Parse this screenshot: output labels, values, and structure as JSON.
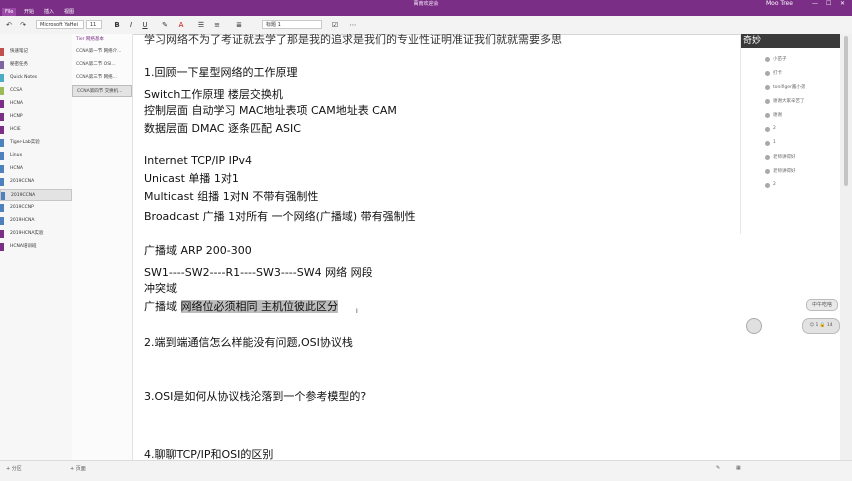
{
  "window": {
    "title": "萬南欢迎会",
    "right_label": "Moo Tree",
    "controls": [
      "—",
      "☐",
      "✕"
    ]
  },
  "menu": [
    "File",
    "开始",
    "插入",
    "视图"
  ],
  "ribbon": {
    "font_name": "Microsoft YaHei",
    "font_size": "11",
    "style_label": "标题 1",
    "buttons": [
      "B",
      "I",
      "U"
    ]
  },
  "sections": {
    "heading": "",
    "items": [
      {
        "label": "快速笔记",
        "color": "#c0504d"
      },
      {
        "label": "秘密任务",
        "color": "#8064a2"
      },
      {
        "label": "Quick Notes",
        "color": "#4bacc6"
      },
      {
        "label": "CCSA",
        "color": "#9bbb59"
      },
      {
        "label": "HCNA",
        "color": "#7a2e86"
      },
      {
        "label": "HCNP",
        "color": "#7a2e86"
      },
      {
        "label": "HCIE",
        "color": "#7a2e86"
      },
      {
        "label": "Tiger-Lab实验",
        "color": "#4f81bd"
      },
      {
        "label": "Linux",
        "color": "#4f81bd"
      },
      {
        "label": "HCNA",
        "color": "#4f81bd"
      },
      {
        "label": "2019CCNA",
        "color": "#4f81bd"
      },
      {
        "label": "2019CCNA",
        "color": "#4f81bd"
      },
      {
        "label": "2019CCNP",
        "color": "#4f81bd"
      },
      {
        "label": "2019HCNA",
        "color": "#4f81bd"
      },
      {
        "label": "2019HCNA实验",
        "color": "#7a2e86"
      },
      {
        "label": "HCNA培训班",
        "color": "#7a2e86"
      }
    ],
    "selected_index": 11,
    "add_label": "+ 分区"
  },
  "pages": {
    "heading": "Tier 网络基本",
    "items": [
      "CCNA第一节 网络介...",
      "CCNA第二节 OSI...",
      "CCNA第三节 网络...",
      "CCNA第四节 交换机..."
    ],
    "selected_index": 3,
    "add_label": "+ 页面"
  },
  "note": {
    "top_cut": "学习网络不为了考证就去学了那是我的追求是我们的专业性证明准证我们就就需要多思",
    "lines": [
      {
        "text": "1.回顾一下星型网络的工作原理"
      },
      {
        "text": "Switch工作原理 楼层交换机"
      },
      {
        "text": "控制层面  自动学习  MAC地址表项  CAM地址表  CAM"
      },
      {
        "text": "数据层面   DMAC  逐条匹配  ASIC"
      },
      {
        "text": "Internet TCP/IP IPv4"
      },
      {
        "text": "Unicast  单播  1对1"
      },
      {
        "text": "Multicast  组播  1对N  不带有强制性"
      },
      {
        "text": "Broadcast  广播  1对所有   一个网络(广播域)  带有强制性"
      },
      {
        "text": "广播域   ARP 200-300"
      },
      {
        "text": "SW1----SW2----R1----SW3----SW4  网络  网段"
      },
      {
        "text": "冲突域"
      },
      {
        "text": "广播域 ",
        "highlight": "网络位必须相同   主机位彼此区分"
      },
      {
        "text": "2.端到端通信怎么样能没有问题,OSI协议栈"
      },
      {
        "text": "3.OSI是如何从协议栈沦落到一个参考模型的?"
      },
      {
        "text": "4.聊聊TCP/IP和OSI的区别"
      }
    ]
  },
  "chat": {
    "banner": "奇妙",
    "messages": [
      "小苗子",
      "打卡",
      "tonifiger酱小弟",
      "谢谢大家辛苦了",
      "谢谢",
      "2",
      "1",
      "老师讲得好",
      "老师讲得好",
      "2"
    ],
    "bubble1": "中午吃啥",
    "bubble2": "☺ 1 🔒 14"
  }
}
